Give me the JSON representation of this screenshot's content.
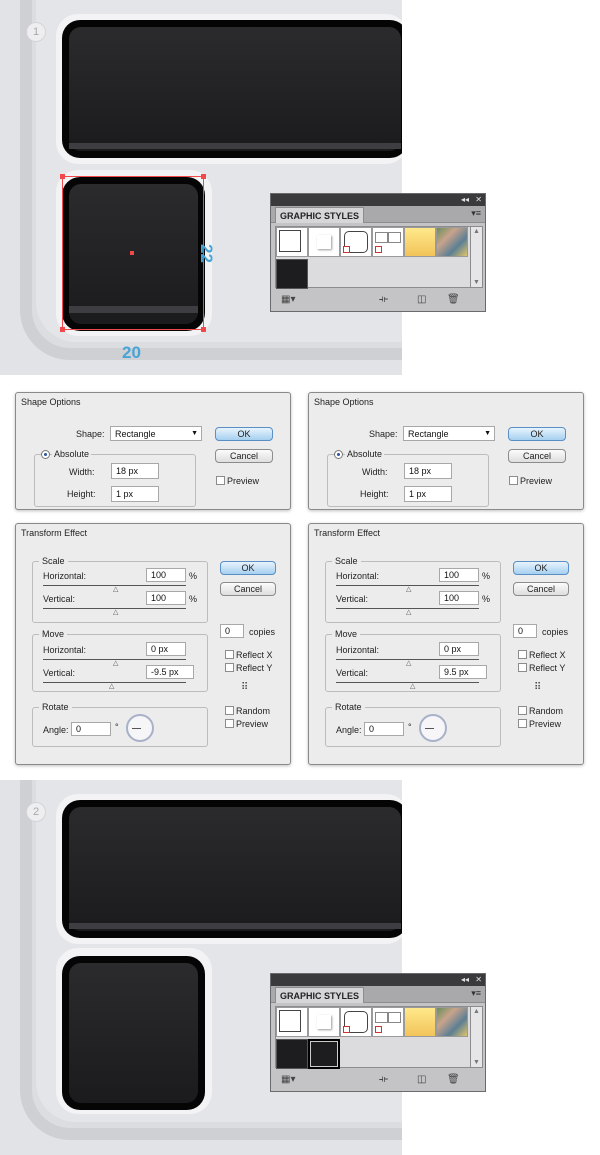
{
  "step1": {
    "badge": "1",
    "dim_width": "20",
    "dim_height": "22"
  },
  "step2": {
    "badge": "2"
  },
  "graphic_styles": {
    "title": "GRAPHIC STYLES",
    "collapse_label": "◂◂",
    "close_label": "✕",
    "menu_label": "▾≡",
    "swatches": [
      "default-style",
      "drop-shadow-style",
      "rounded-outline-style",
      "split-outline-style",
      "yellow-gradient-style",
      "textured-style"
    ],
    "custom_swatch_count_step1": 1,
    "custom_swatch_count_step2": 2
  },
  "shape_options_left": {
    "title": "Shape Options",
    "shape_label": "Shape:",
    "shape_value": "Rectangle",
    "absolute_label": "Absolute",
    "width_label": "Width:",
    "width_value": "18 px",
    "height_label": "Height:",
    "height_value": "1 px",
    "ok_label": "OK",
    "cancel_label": "Cancel",
    "preview_label": "Preview"
  },
  "shape_options_right": {
    "title": "Shape Options",
    "shape_label": "Shape:",
    "shape_value": "Rectangle",
    "absolute_label": "Absolute",
    "width_label": "Width:",
    "width_value": "18 px",
    "height_label": "Height:",
    "height_value": "1 px",
    "ok_label": "OK",
    "cancel_label": "Cancel",
    "preview_label": "Preview"
  },
  "transform_left": {
    "title": "Transform Effect",
    "scale_legend": "Scale",
    "scale_h_label": "Horizontal:",
    "scale_h_value": "100",
    "scale_v_label": "Vertical:",
    "scale_v_value": "100",
    "percent": "%",
    "move_legend": "Move",
    "move_h_label": "Horizontal:",
    "move_h_value": "0 px",
    "move_v_label": "Vertical:",
    "move_v_value": "-9.5 px",
    "rotate_legend": "Rotate",
    "angle_label": "Angle:",
    "angle_value": "0",
    "degree": "°",
    "ok_label": "OK",
    "cancel_label": "Cancel",
    "copies_value": "0",
    "copies_label": "copies",
    "reflect_x_label": "Reflect X",
    "reflect_y_label": "Reflect Y",
    "random_label": "Random",
    "preview_label": "Preview"
  },
  "transform_right": {
    "title": "Transform Effect",
    "scale_legend": "Scale",
    "scale_h_label": "Horizontal:",
    "scale_h_value": "100",
    "scale_v_label": "Vertical:",
    "scale_v_value": "100",
    "percent": "%",
    "move_legend": "Move",
    "move_h_label": "Horizontal:",
    "move_h_value": "0 px",
    "move_v_label": "Vertical:",
    "move_v_value": "9.5 px",
    "rotate_legend": "Rotate",
    "angle_label": "Angle:",
    "angle_value": "0",
    "degree": "°",
    "ok_label": "OK",
    "cancel_label": "Cancel",
    "copies_value": "0",
    "copies_label": "copies",
    "reflect_x_label": "Reflect X",
    "reflect_y_label": "Reflect Y",
    "random_label": "Random",
    "preview_label": "Preview"
  },
  "colors": {
    "selection": "#f0484b",
    "dimension_text": "#48a3d6",
    "ok_button": "#a6cff0"
  }
}
